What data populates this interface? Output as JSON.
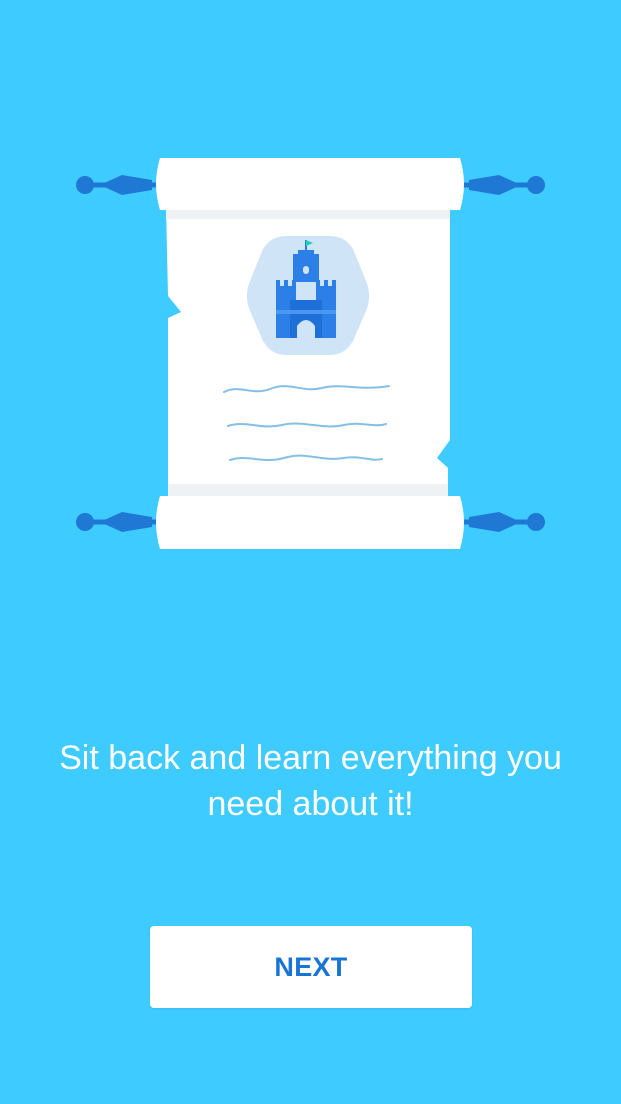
{
  "onboarding": {
    "message_line1": "Sit back and learn everything you",
    "message_line2": "need about it!",
    "next_label": "NEXT"
  },
  "illustration": {
    "icons": [
      "scroll-icon",
      "castle-icon"
    ]
  },
  "colors": {
    "background": "#3ecbff",
    "accent": "#1a74d6",
    "scroll_paper": "#ffffff",
    "castle": "#2b7fe6",
    "badge": "#cfe4f7",
    "rod": "#1e78d4"
  }
}
